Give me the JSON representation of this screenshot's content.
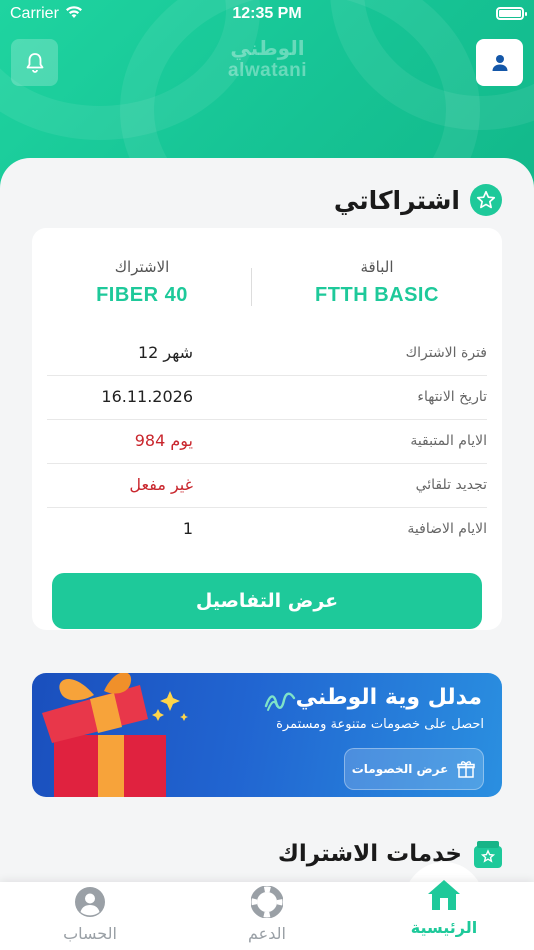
{
  "status_bar": {
    "carrier": "Carrier",
    "time": "12:35 PM"
  },
  "header": {
    "logo_ar": "الوطني",
    "logo_en": "alwatani"
  },
  "subscriptions": {
    "title": "اشتراكاتي",
    "package_label": "الباقة",
    "package_value": "FTTH BASIC",
    "subscription_label": "الاشتراك",
    "subscription_value": "FIBER 40",
    "rows": [
      {
        "key": "فترة الاشتراك",
        "value": "12 شهر"
      },
      {
        "key": "تاريخ الانتهاء",
        "value": "16.11.2026"
      },
      {
        "key": "الايام المتبقية",
        "value": "984 يوم"
      },
      {
        "key": "تجديد تلقائي",
        "value": "غير مفعل"
      },
      {
        "key": "الايام الاضافية",
        "value": "1"
      }
    ],
    "details_button": "عرض التفاصيل"
  },
  "banner": {
    "title": "مدلل وية الوطني",
    "subtitle": "احصل على خصومات متنوعة ومستمرة",
    "button": "عرض الخصومات"
  },
  "services": {
    "title": "خدمات الاشتراك"
  },
  "tabbar": {
    "home": "الرئيسية",
    "support": "الدعم",
    "account": "الحساب"
  },
  "colors": {
    "brand": "#1ec99a",
    "warning": "#c9262d",
    "banner": "#2165d1"
  },
  "icons": {
    "bell": "bell-icon",
    "user": "user-icon",
    "star": "star-icon",
    "gift": "gift-icon",
    "home": "home-icon",
    "support": "lifebuoy-icon",
    "account": "account-icon"
  }
}
